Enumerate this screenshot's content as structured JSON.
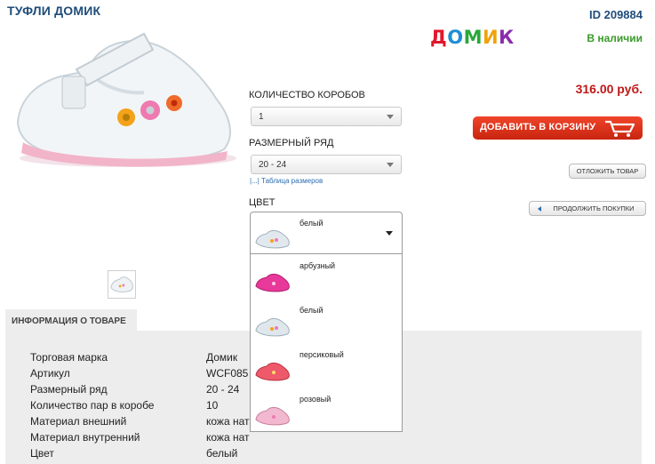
{
  "product": {
    "title": "ТУФЛИ ДОМИК",
    "id_label": "ID 209884",
    "brand_letters": [
      "Д",
      "О",
      "М",
      "И",
      "К"
    ],
    "brand_colors": [
      "#e0182a",
      "#1d8fd6",
      "#2aa83a",
      "#f0a20a",
      "#8a2cae"
    ],
    "stock": "В наличии",
    "price": "316.00 руб."
  },
  "options": {
    "boxes_label": "КОЛИЧЕСТВО КОРОБОВ",
    "boxes_value": "1",
    "size_label": "РАЗМЕРНЫЙ РЯД",
    "size_value": "20 - 24",
    "size_table_link": "|...| Таблица размеров",
    "color_label": "ЦВЕТ",
    "color_value": "белый",
    "color_options": [
      {
        "label": "арбузный",
        "color": "#e8389a"
      },
      {
        "label": "белый",
        "color": "#dfe7ec"
      },
      {
        "label": "персиковый",
        "color": "#ee5a6a"
      },
      {
        "label": "розовый",
        "color": "#f2b8d0"
      }
    ]
  },
  "actions": {
    "add_to_cart": "ДОБАВИТЬ В КОРЗИНУ",
    "defer": "ОТЛОЖИТЬ ТОВАР",
    "continue": "ПРОДОЛЖИТЬ ПОКУПКИ"
  },
  "info": {
    "tab_label": "ИНФОРМАЦИЯ О ТОВАРЕ",
    "rows": [
      {
        "key": "Торговая марка",
        "value": "Домик"
      },
      {
        "key": "Артикул",
        "value": "WCF085"
      },
      {
        "key": "Размерный ряд",
        "value": "20 - 24"
      },
      {
        "key": "Количество пар в коробе",
        "value": "10"
      },
      {
        "key": "Материал внешний",
        "value": "кожа нат"
      },
      {
        "key": "Материал внутренний",
        "value": "кожа нат"
      },
      {
        "key": "Цвет",
        "value": "белый"
      }
    ]
  }
}
